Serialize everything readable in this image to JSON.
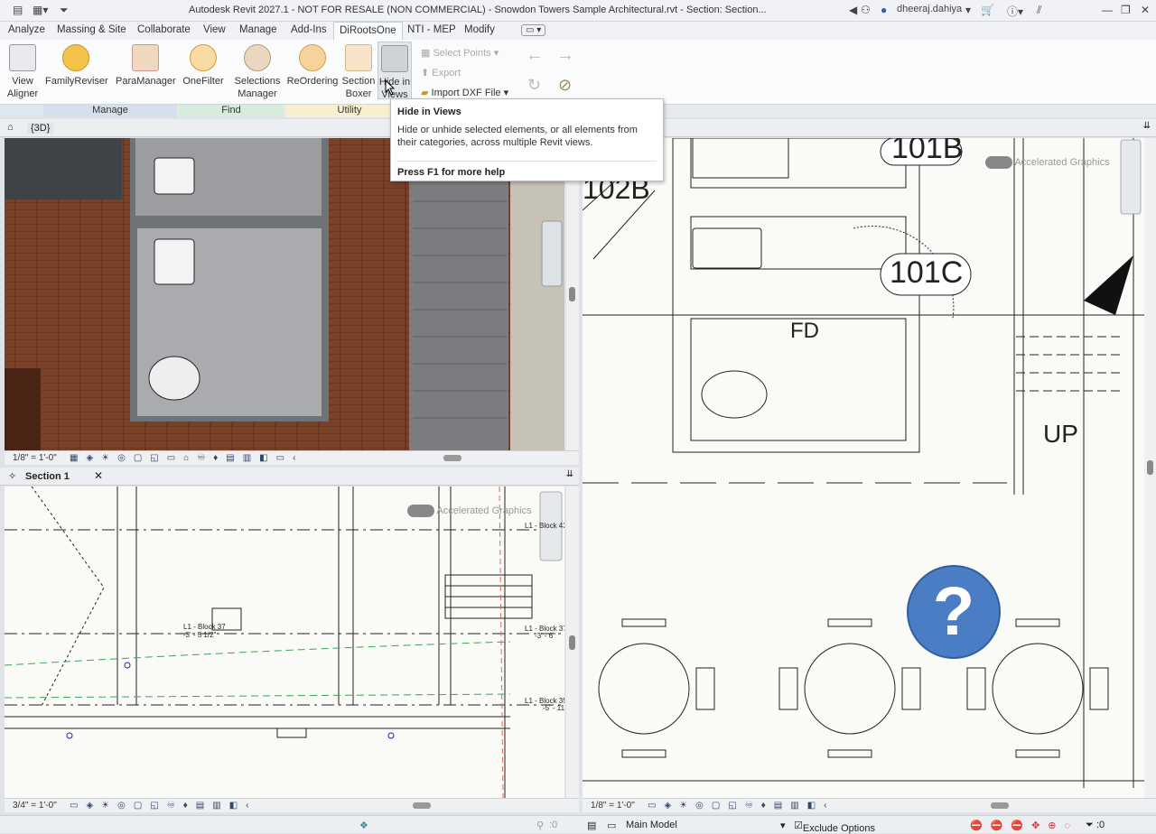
{
  "titlebar": {
    "title": "Autodesk Revit 2027.1 - NOT FOR RESALE (NON COMMERCIAL) - Snowdon Towers Sample Architectural.rvt - Section: Section...",
    "user": "dheeraj.dahiya"
  },
  "tabs": [
    "Analyze",
    "Massing & Site",
    "Collaborate",
    "View",
    "Manage",
    "Add-Ins",
    "DiRootsOne",
    "NTI - MEP",
    "Modify"
  ],
  "ribbon": {
    "buttons": [
      {
        "label1": "View",
        "label2": "Aligner",
        "color": "#e9e9ef"
      },
      {
        "label1": "FamilyReviser",
        "label2": "",
        "color": "#f3c34a"
      },
      {
        "label1": "ParaManager",
        "label2": "",
        "color": "#f0d8bf"
      },
      {
        "label1": "OneFilter",
        "label2": "",
        "color": "#fadba4"
      },
      {
        "label1": "Selections",
        "label2": "Manager",
        "color": "#e9d7c0"
      },
      {
        "label1": "ReOrdering",
        "label2": "",
        "color": "#f6d39d"
      },
      {
        "label1": "Section",
        "label2": "Boxer",
        "color": "#f6e3c8"
      },
      {
        "label1": "Hide in",
        "label2": "Views",
        "color": "#cfd3d8"
      }
    ],
    "select_points": "Select Points",
    "export": "Export",
    "import_dxf": "Import DXF File",
    "groups": [
      "Manage",
      "Find",
      "Utility"
    ]
  },
  "tooltip": {
    "title": "Hide in Views",
    "body": "Hide or unhide selected elements, or all elements from their categories, across multiple Revit views.",
    "footer": "Press F1 for more help"
  },
  "views": {
    "view3d": {
      "tab": "{3D}",
      "scale": "1/8\" = 1'-0\""
    },
    "section": {
      "tab": "Section 1",
      "scale": "3/4\" = 1'-0\"",
      "accel": "Accelerated Graphics",
      "tags": [
        "L1 - Block 43",
        "L1 - Block 37",
        "-3' - 5 1/2\"",
        "L1 - Block 37",
        "-3' - 6\"",
        "L1 - Block 35",
        "-5' - 11\""
      ]
    },
    "plan": {
      "scale": "1/8\" = 1'-0\"",
      "accel": "Accelerated Graphics",
      "rooms": [
        "101B",
        "102B",
        "101C",
        "FD",
        "UP"
      ]
    }
  },
  "status": {
    "model": "Main Model",
    "exclude": "Exclude Options",
    "filter_count": ":0",
    "select_count": ":0"
  }
}
